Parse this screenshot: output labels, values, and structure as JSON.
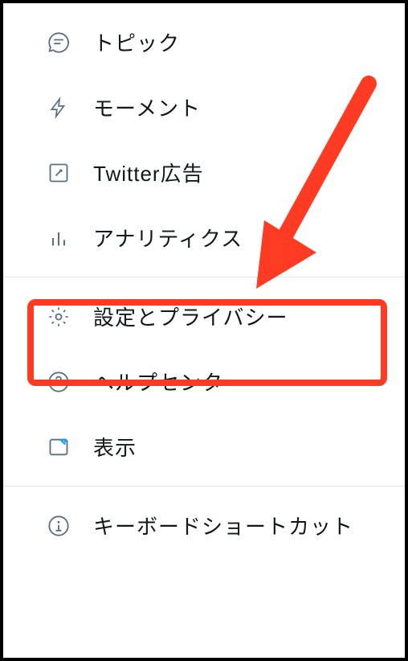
{
  "menu": {
    "items": [
      {
        "label": "トピック",
        "icon": "topic"
      },
      {
        "label": "モーメント",
        "icon": "moment"
      },
      {
        "label": "Twitter広告",
        "icon": "ad"
      },
      {
        "label": "アナリティクス",
        "icon": "analytics"
      },
      {
        "label": "設定とプライバシー",
        "icon": "settings",
        "highlighted": true
      },
      {
        "label": "ヘルプセンター",
        "icon": "help"
      },
      {
        "label": "表示",
        "icon": "display"
      },
      {
        "label": "キーボードショートカット",
        "icon": "keyboard"
      }
    ]
  },
  "annotation": {
    "arrow_color": "#ff3b24",
    "highlight_color": "#ff3b24"
  }
}
